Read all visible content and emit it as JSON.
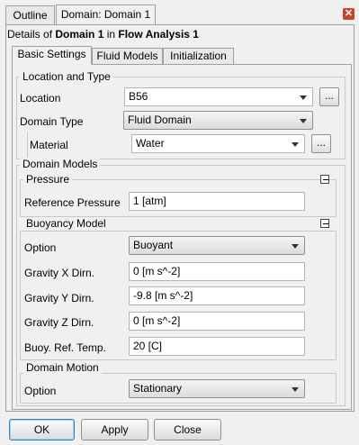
{
  "tabs": {
    "outline": "Outline",
    "domain": "Domain: Domain 1"
  },
  "header": {
    "prefix": "Details of ",
    "object": "Domain 1",
    "middle": " in ",
    "analysis": "Flow Analysis 1"
  },
  "subtabs": {
    "basic": "Basic Settings",
    "fluid": "Fluid Models",
    "init": "Initialization"
  },
  "location_type": {
    "title": "Location and Type",
    "location_label": "Location",
    "location_value": "B56",
    "domain_type_label": "Domain Type",
    "domain_type_value": "Fluid Domain",
    "material_label": "Material",
    "material_value": "Water",
    "browse": "..."
  },
  "domain_models": {
    "title": "Domain Models",
    "pressure": {
      "title": "Pressure",
      "ref_label": "Reference Pressure",
      "ref_value": "1 [atm]"
    },
    "buoyancy": {
      "title": "Buoyancy Model",
      "option_label": "Option",
      "option_value": "Buoyant",
      "gx_label": "Gravity X Dirn.",
      "gx_value": "0 [m s^-2]",
      "gy_label": "Gravity Y Dirn.",
      "gy_value": "-9.8 [m s^-2]",
      "gz_label": "Gravity Z Dirn.",
      "gz_value": "0 [m s^-2]",
      "temp_label": "Buoy. Ref. Temp.",
      "temp_value": "20 [C]"
    },
    "motion": {
      "title": "Domain Motion",
      "option_label": "Option",
      "option_value": "Stationary"
    }
  },
  "buttons": {
    "ok": "OK",
    "apply": "Apply",
    "close": "Close"
  }
}
